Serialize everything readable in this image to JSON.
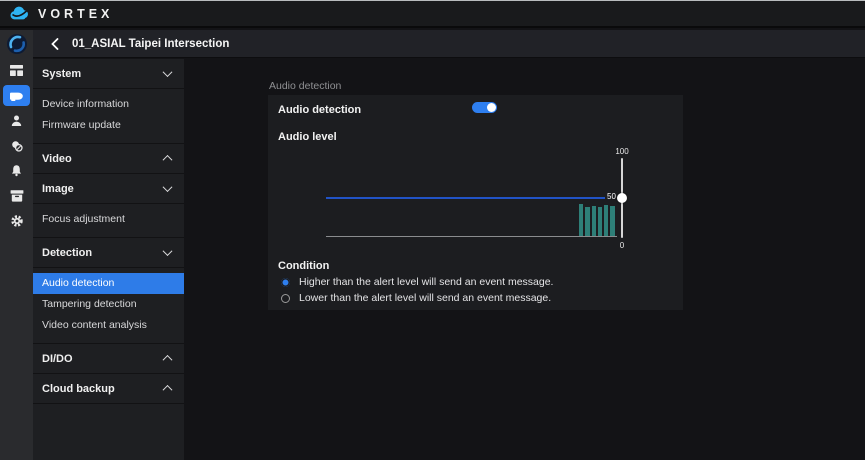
{
  "topbar": {
    "brand": "VORTEX"
  },
  "titlebar": {
    "device_name": "01_ASIAL Taipei Intersection"
  },
  "rail": {
    "items": [
      {
        "icon": "dashboard-icon",
        "active": false
      },
      {
        "icon": "camera-icon",
        "active": true
      },
      {
        "icon": "user-icon",
        "active": false
      },
      {
        "icon": "overlapping-circles-icon",
        "active": false
      },
      {
        "icon": "bell-icon",
        "active": false
      },
      {
        "icon": "archive-box-icon",
        "active": false
      },
      {
        "icon": "gear-icon",
        "active": false
      }
    ]
  },
  "sidebar": {
    "sections": [
      {
        "label": "System",
        "chevron": "down",
        "items": [
          {
            "label": "Device information",
            "active": false
          },
          {
            "label": "Firmware update",
            "active": false
          }
        ]
      },
      {
        "label": "Video",
        "chevron": "up",
        "items": []
      },
      {
        "label": "Image",
        "chevron": "down",
        "items": [
          {
            "label": "Focus adjustment",
            "active": false
          }
        ]
      },
      {
        "label": "Detection",
        "chevron": "down",
        "items": [
          {
            "label": "Audio detection",
            "active": true
          },
          {
            "label": "Tampering detection",
            "active": false
          },
          {
            "label": "Video content analysis",
            "active": false
          }
        ]
      },
      {
        "label": "DI/DO",
        "chevron": "up",
        "items": []
      },
      {
        "label": "Cloud backup",
        "chevron": "up",
        "items": []
      }
    ]
  },
  "main": {
    "page_title": "Audio detection",
    "audio_toggle": {
      "label": "Audio detection",
      "state": "on"
    },
    "audio_level_label": "Audio level",
    "condition": {
      "label": "Condition",
      "options": [
        {
          "label": "Higher than the alert level will send an event message.",
          "selected": true
        },
        {
          "label": "Lower than the alert level will send an event message.",
          "selected": false
        }
      ]
    }
  },
  "chart_data": {
    "type": "bar",
    "title": "Audio level",
    "xlabel": "",
    "ylabel": "",
    "ylim": [
      0,
      100
    ],
    "grid": false,
    "axis_max_label": "100",
    "axis_min_label": "0",
    "alert_level": 50,
    "alert_level_label": "50",
    "slider": {
      "min": 0,
      "max": 100,
      "value": 50
    },
    "bars": [
      40,
      36,
      38,
      36,
      39,
      37
    ]
  },
  "colors": {
    "accent_blue": "#2e7ff0",
    "active_item_blue": "#2e7ce8",
    "alert_line_blue": "#2153c6",
    "bar_teal": "#2e7f78",
    "logo_blue": "#2eb3f2"
  }
}
